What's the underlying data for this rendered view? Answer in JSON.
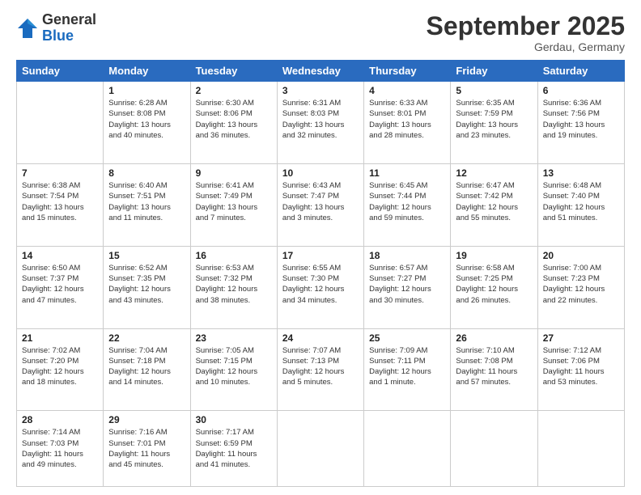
{
  "logo": {
    "general": "General",
    "blue": "Blue"
  },
  "header": {
    "title": "September 2025",
    "subtitle": "Gerdau, Germany"
  },
  "weekdays": [
    "Sunday",
    "Monday",
    "Tuesday",
    "Wednesday",
    "Thursday",
    "Friday",
    "Saturday"
  ],
  "weeks": [
    [
      {
        "day": "",
        "info": ""
      },
      {
        "day": "1",
        "info": "Sunrise: 6:28 AM\nSunset: 8:08 PM\nDaylight: 13 hours\nand 40 minutes."
      },
      {
        "day": "2",
        "info": "Sunrise: 6:30 AM\nSunset: 8:06 PM\nDaylight: 13 hours\nand 36 minutes."
      },
      {
        "day": "3",
        "info": "Sunrise: 6:31 AM\nSunset: 8:03 PM\nDaylight: 13 hours\nand 32 minutes."
      },
      {
        "day": "4",
        "info": "Sunrise: 6:33 AM\nSunset: 8:01 PM\nDaylight: 13 hours\nand 28 minutes."
      },
      {
        "day": "5",
        "info": "Sunrise: 6:35 AM\nSunset: 7:59 PM\nDaylight: 13 hours\nand 23 minutes."
      },
      {
        "day": "6",
        "info": "Sunrise: 6:36 AM\nSunset: 7:56 PM\nDaylight: 13 hours\nand 19 minutes."
      }
    ],
    [
      {
        "day": "7",
        "info": "Sunrise: 6:38 AM\nSunset: 7:54 PM\nDaylight: 13 hours\nand 15 minutes."
      },
      {
        "day": "8",
        "info": "Sunrise: 6:40 AM\nSunset: 7:51 PM\nDaylight: 13 hours\nand 11 minutes."
      },
      {
        "day": "9",
        "info": "Sunrise: 6:41 AM\nSunset: 7:49 PM\nDaylight: 13 hours\nand 7 minutes."
      },
      {
        "day": "10",
        "info": "Sunrise: 6:43 AM\nSunset: 7:47 PM\nDaylight: 13 hours\nand 3 minutes."
      },
      {
        "day": "11",
        "info": "Sunrise: 6:45 AM\nSunset: 7:44 PM\nDaylight: 12 hours\nand 59 minutes."
      },
      {
        "day": "12",
        "info": "Sunrise: 6:47 AM\nSunset: 7:42 PM\nDaylight: 12 hours\nand 55 minutes."
      },
      {
        "day": "13",
        "info": "Sunrise: 6:48 AM\nSunset: 7:40 PM\nDaylight: 12 hours\nand 51 minutes."
      }
    ],
    [
      {
        "day": "14",
        "info": "Sunrise: 6:50 AM\nSunset: 7:37 PM\nDaylight: 12 hours\nand 47 minutes."
      },
      {
        "day": "15",
        "info": "Sunrise: 6:52 AM\nSunset: 7:35 PM\nDaylight: 12 hours\nand 43 minutes."
      },
      {
        "day": "16",
        "info": "Sunrise: 6:53 AM\nSunset: 7:32 PM\nDaylight: 12 hours\nand 38 minutes."
      },
      {
        "day": "17",
        "info": "Sunrise: 6:55 AM\nSunset: 7:30 PM\nDaylight: 12 hours\nand 34 minutes."
      },
      {
        "day": "18",
        "info": "Sunrise: 6:57 AM\nSunset: 7:27 PM\nDaylight: 12 hours\nand 30 minutes."
      },
      {
        "day": "19",
        "info": "Sunrise: 6:58 AM\nSunset: 7:25 PM\nDaylight: 12 hours\nand 26 minutes."
      },
      {
        "day": "20",
        "info": "Sunrise: 7:00 AM\nSunset: 7:23 PM\nDaylight: 12 hours\nand 22 minutes."
      }
    ],
    [
      {
        "day": "21",
        "info": "Sunrise: 7:02 AM\nSunset: 7:20 PM\nDaylight: 12 hours\nand 18 minutes."
      },
      {
        "day": "22",
        "info": "Sunrise: 7:04 AM\nSunset: 7:18 PM\nDaylight: 12 hours\nand 14 minutes."
      },
      {
        "day": "23",
        "info": "Sunrise: 7:05 AM\nSunset: 7:15 PM\nDaylight: 12 hours\nand 10 minutes."
      },
      {
        "day": "24",
        "info": "Sunrise: 7:07 AM\nSunset: 7:13 PM\nDaylight: 12 hours\nand 5 minutes."
      },
      {
        "day": "25",
        "info": "Sunrise: 7:09 AM\nSunset: 7:11 PM\nDaylight: 12 hours\nand 1 minute."
      },
      {
        "day": "26",
        "info": "Sunrise: 7:10 AM\nSunset: 7:08 PM\nDaylight: 11 hours\nand 57 minutes."
      },
      {
        "day": "27",
        "info": "Sunrise: 7:12 AM\nSunset: 7:06 PM\nDaylight: 11 hours\nand 53 minutes."
      }
    ],
    [
      {
        "day": "28",
        "info": "Sunrise: 7:14 AM\nSunset: 7:03 PM\nDaylight: 11 hours\nand 49 minutes."
      },
      {
        "day": "29",
        "info": "Sunrise: 7:16 AM\nSunset: 7:01 PM\nDaylight: 11 hours\nand 45 minutes."
      },
      {
        "day": "30",
        "info": "Sunrise: 7:17 AM\nSunset: 6:59 PM\nDaylight: 11 hours\nand 41 minutes."
      },
      {
        "day": "",
        "info": ""
      },
      {
        "day": "",
        "info": ""
      },
      {
        "day": "",
        "info": ""
      },
      {
        "day": "",
        "info": ""
      }
    ]
  ]
}
